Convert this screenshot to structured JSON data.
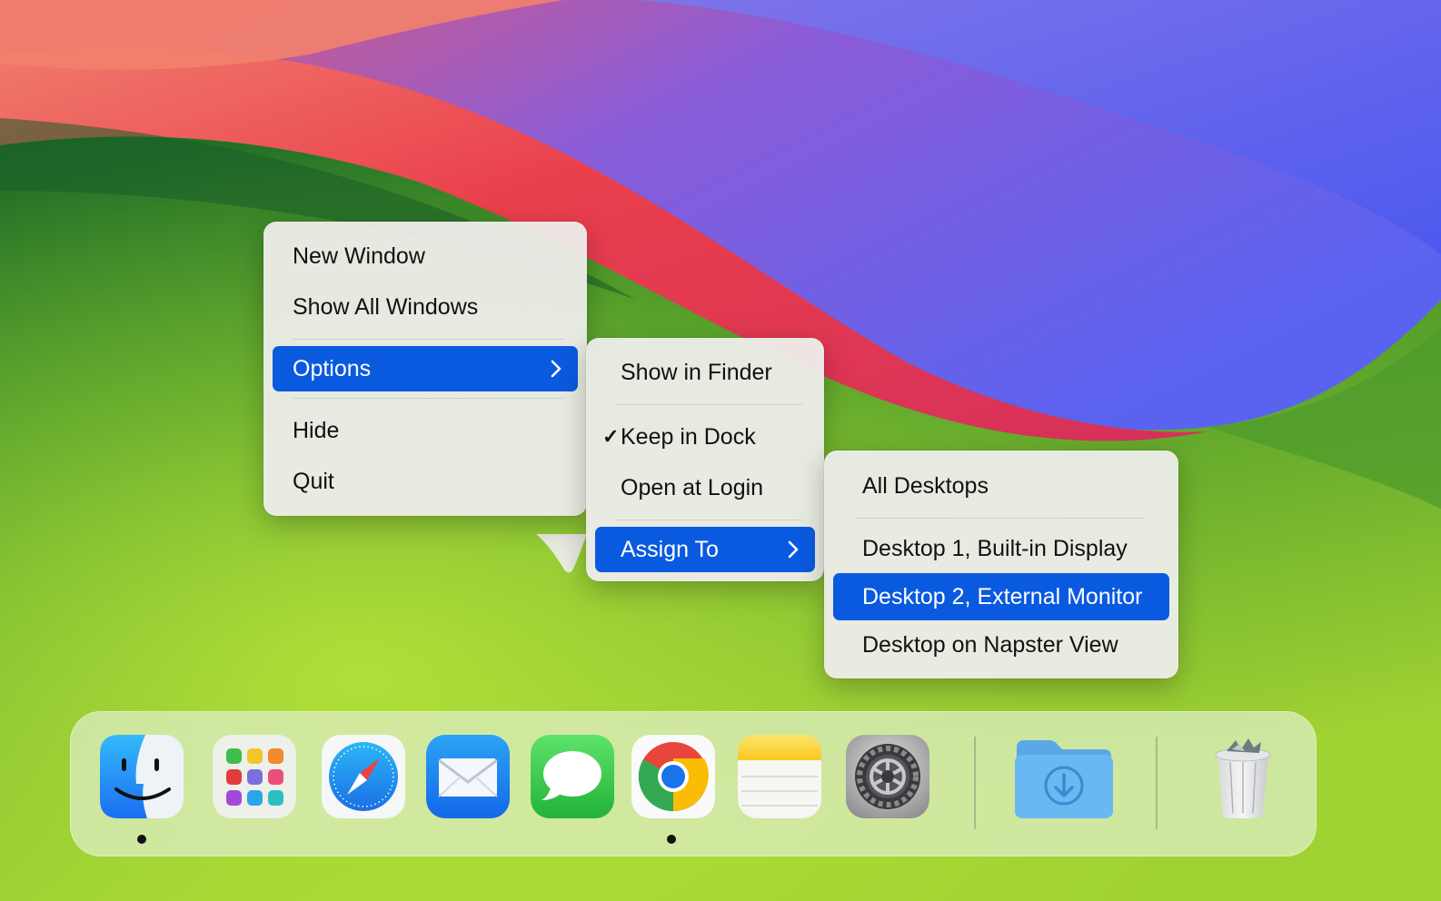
{
  "context_menu": {
    "items": [
      {
        "label": "New Window"
      },
      {
        "label": "Show All Windows"
      },
      {
        "label": "Options",
        "selected": true
      },
      {
        "label": "Hide"
      },
      {
        "label": "Quit"
      }
    ]
  },
  "options_submenu": {
    "items": [
      {
        "label": "Show in Finder"
      },
      {
        "label": "Keep in Dock",
        "checked": true,
        "check_mark": "✓"
      },
      {
        "label": "Open at Login"
      },
      {
        "label": "Assign To",
        "selected": true
      }
    ]
  },
  "assign_submenu": {
    "items": [
      {
        "label": "All Desktops"
      },
      {
        "label": "Desktop 1, Built-in Display"
      },
      {
        "label": "Desktop 2, External Monitor",
        "selected": true
      },
      {
        "label": "Desktop on Napster View"
      }
    ]
  },
  "dock": {
    "apps": [
      {
        "name": "finder-icon",
        "running": true
      },
      {
        "name": "launchpad-icon",
        "running": false
      },
      {
        "name": "safari-icon",
        "running": false
      },
      {
        "name": "mail-icon",
        "running": false
      },
      {
        "name": "messages-icon",
        "running": false
      },
      {
        "name": "chrome-icon",
        "running": true
      },
      {
        "name": "notes-icon",
        "running": false
      },
      {
        "name": "system-settings-icon",
        "running": false
      },
      {
        "name": "downloads-folder-icon",
        "running": false
      },
      {
        "name": "trash-icon",
        "running": false
      }
    ]
  },
  "colors": {
    "selection": "#0a5ae0",
    "menu_background": "#ececE8",
    "wallpaper_green": "#3f8a2a",
    "wallpaper_red": "#e8404f",
    "wallpaper_purple": "#6a5ae8"
  }
}
